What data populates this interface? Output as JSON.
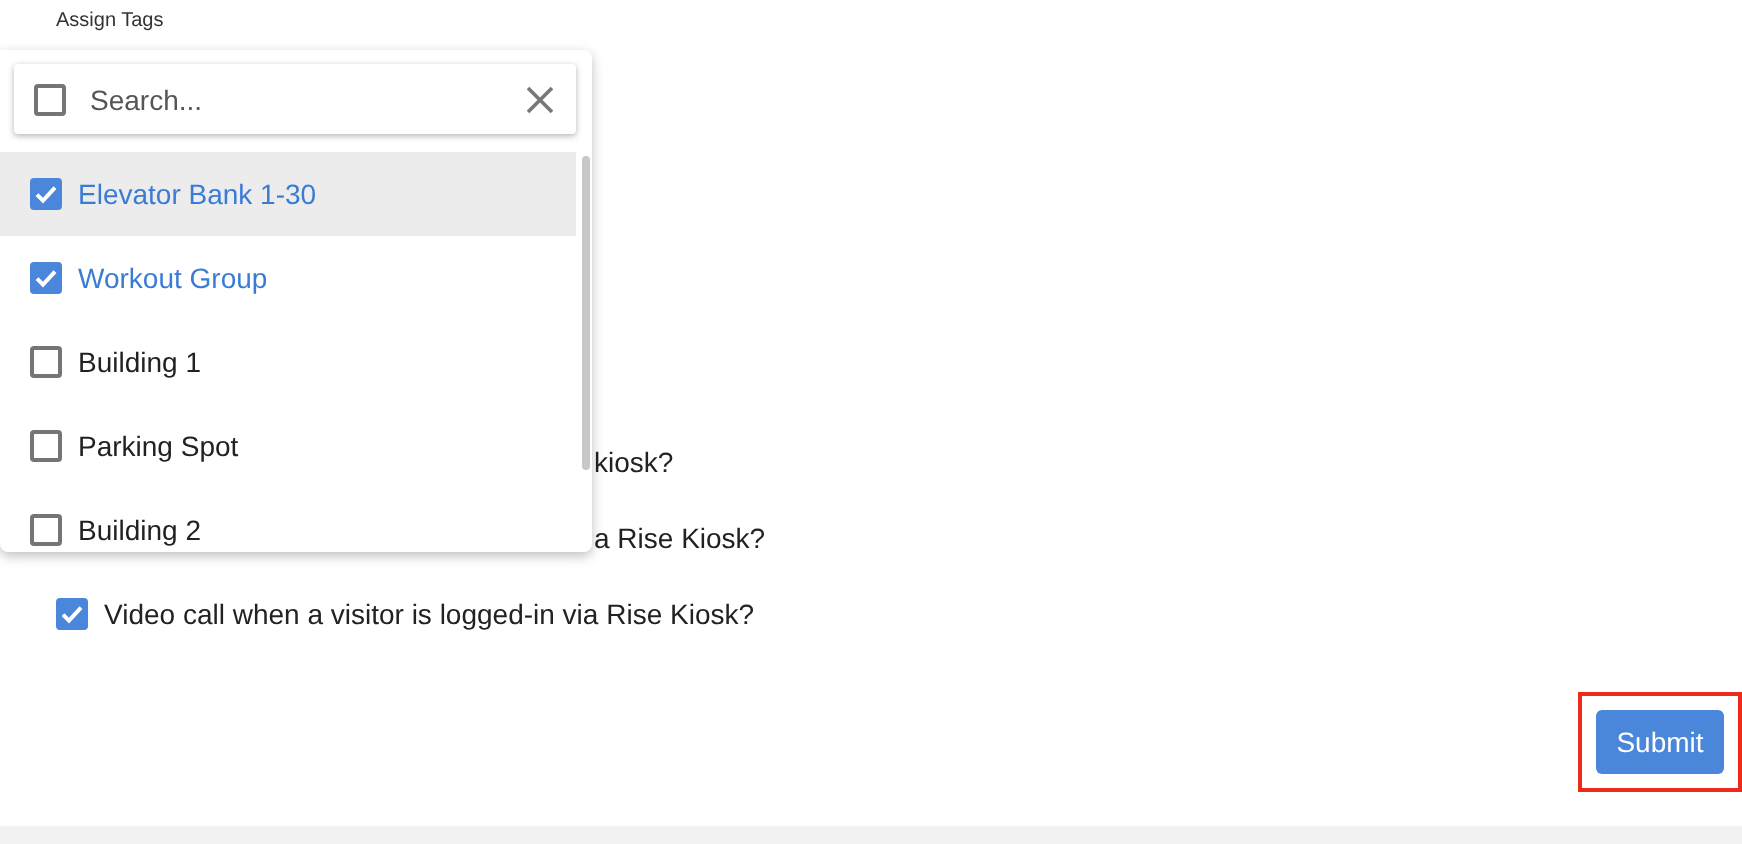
{
  "field_label": "Assign Tags",
  "tag_dropdown": {
    "search": {
      "placeholder": "Search...",
      "checked": false
    },
    "items": [
      {
        "label": "Elevator Bank 1-30",
        "checked": true,
        "selected": true
      },
      {
        "label": "Workout Group",
        "checked": true,
        "selected": false
      },
      {
        "label": "Building 1",
        "checked": false,
        "selected": false
      },
      {
        "label": "Parking Spot",
        "checked": false,
        "selected": false
      },
      {
        "label": "Building 2",
        "checked": false,
        "selected": false
      }
    ]
  },
  "options": [
    {
      "label": "kiosk?",
      "kind": "covered"
    },
    {
      "label": "a Rise Kiosk?",
      "kind": "covered"
    },
    {
      "label": "Video call when a visitor is logged-in via Rise Kiosk?",
      "kind": "checkbox",
      "checked": true
    }
  ],
  "submit_button": {
    "label": "Submit",
    "highlighted": true
  }
}
